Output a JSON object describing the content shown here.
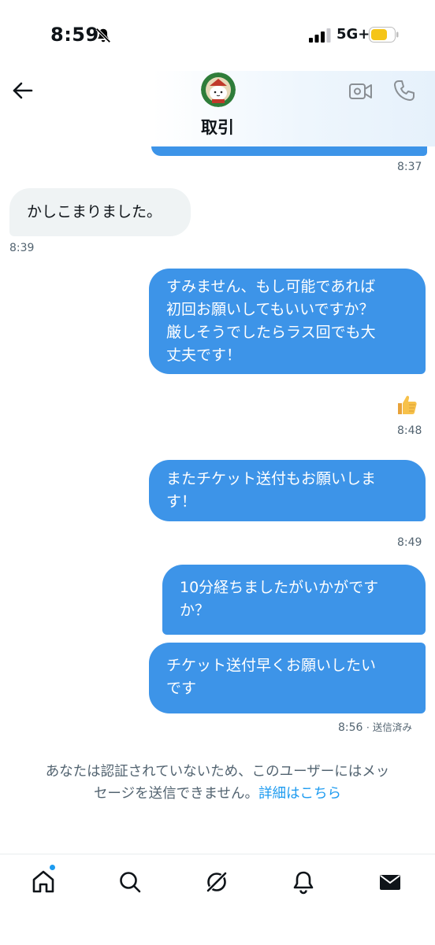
{
  "status_bar": {
    "time": "8:59",
    "network": "5G+",
    "icons": [
      "bell-off-icon",
      "signal-icon",
      "battery-icon"
    ],
    "battery_color": "#f5c518"
  },
  "header": {
    "title": "取引",
    "avatar_icon": "avatar",
    "icons": [
      "back-arrow-icon",
      "video-call-icon",
      "phone-icon"
    ]
  },
  "messages": [
    {
      "direction": "out",
      "time": "8:37"
    },
    {
      "direction": "in",
      "lines": [
        "かしこまりました。"
      ],
      "time": "8:39"
    },
    {
      "direction": "out",
      "lines": [
        "すみません、もし可能であれば",
        "初回お願いしてもいいですか？",
        "厳しそうでしたらラス回でも大",
        "丈夫です！"
      ],
      "reaction": "👍",
      "time": "8:48"
    },
    {
      "direction": "out",
      "lines": [
        "またチケット送付もお願いしま",
        "す！"
      ],
      "time": "8:49"
    },
    {
      "direction": "out",
      "lines": [
        "10分経ちましたがいかがです",
        "か？"
      ]
    },
    {
      "direction": "out",
      "lines": [
        "チケット送付早くお願いしたい",
        "です"
      ],
      "time": "8:56",
      "status": "· 送信済み"
    }
  ],
  "notice": {
    "line1": "あなたは認証されていないため、このユーザーにはメッ",
    "line2_prefix": "セージを送信できません。",
    "link": "詳細はこちら"
  },
  "bottom_nav": {
    "items": [
      "home-icon",
      "search-icon",
      "grok-icon",
      "notifications-icon",
      "messages-icon"
    ],
    "accent": "#1d9bf0"
  },
  "colors": {
    "outgoing_bubble": "#3d94e8",
    "incoming_bubble": "#eff3f4",
    "timestamp": "#536471",
    "link": "#1d9bf0"
  }
}
